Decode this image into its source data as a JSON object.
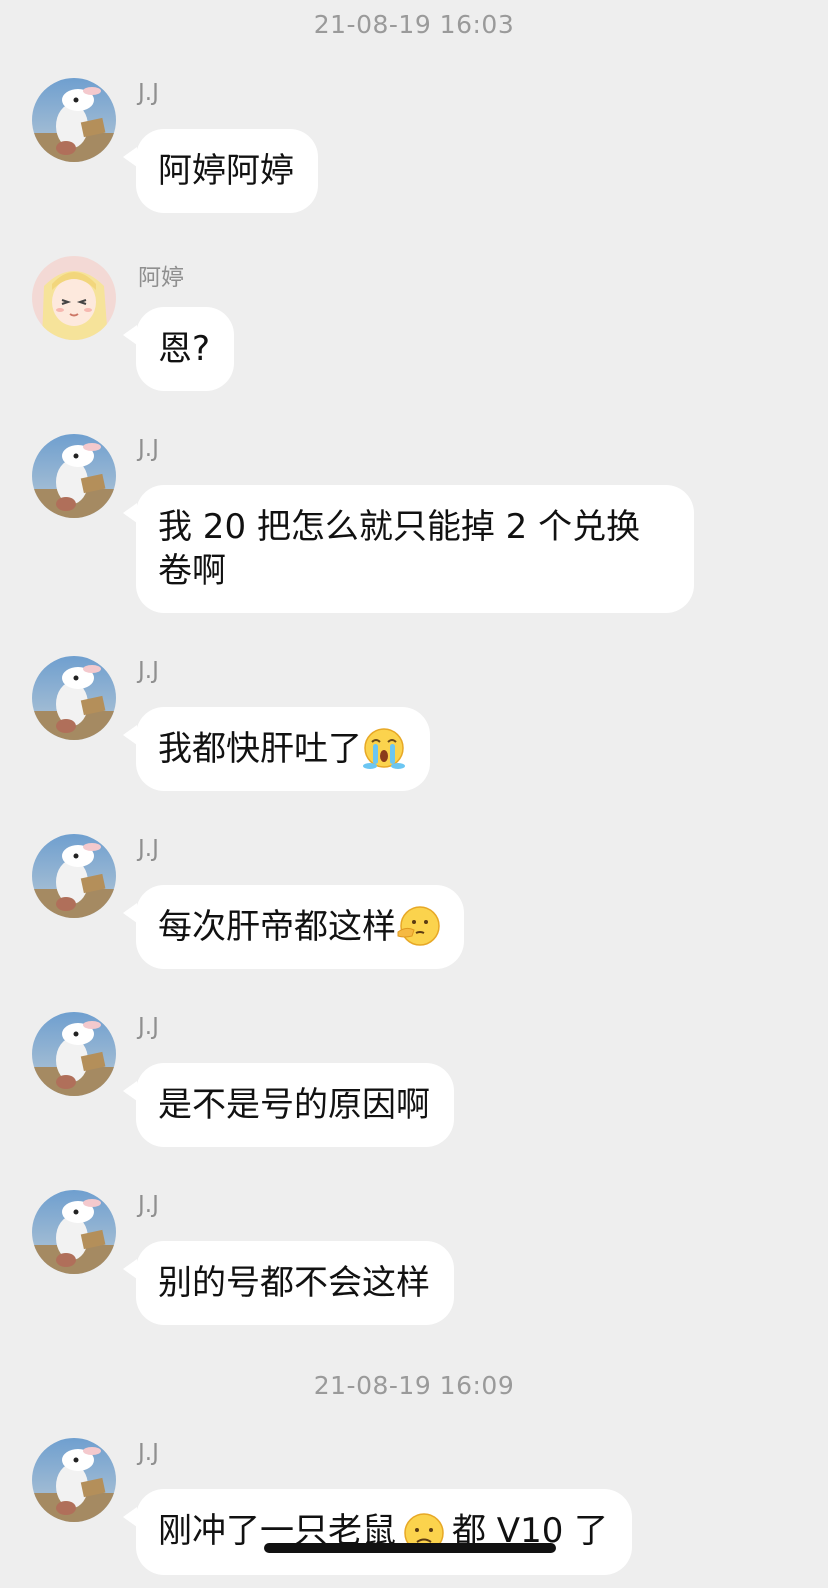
{
  "timestamps": [
    "21-08-19 16:03",
    "21-08-19 16:09"
  ],
  "messages": [
    {
      "sender": "J.J",
      "text": "阿婷阿婷",
      "avatar": "rabbit-avatar"
    },
    {
      "sender": "阿婷",
      "text": "恩?",
      "avatar": "anime-girl-avatar"
    },
    {
      "sender": "J.J",
      "text": "我 20 把怎么就只能掉 2 个兑换卷啊",
      "avatar": "rabbit-avatar"
    },
    {
      "sender": "J.J",
      "text": "我都快肝吐了",
      "emoji": "crying-emoji",
      "avatar": "rabbit-avatar"
    },
    {
      "sender": "J.J",
      "text": "每次肝帝都这样",
      "emoji": "shushing-emoji",
      "avatar": "rabbit-avatar"
    },
    {
      "sender": "J.J",
      "text": "是不是号的原因啊",
      "avatar": "rabbit-avatar"
    },
    {
      "sender": "J.J",
      "text": "别的号都不会这样",
      "avatar": "rabbit-avatar"
    },
    {
      "sender": "J.J",
      "text_before": "刚冲了一只老鼠",
      "emoji": "frown-emoji",
      "text_after": "都 V10 了",
      "avatar": "rabbit-avatar"
    }
  ],
  "colors": {
    "background": "#eeeeee",
    "bubble": "#ffffff",
    "meta_text": "#9a9a9a"
  }
}
